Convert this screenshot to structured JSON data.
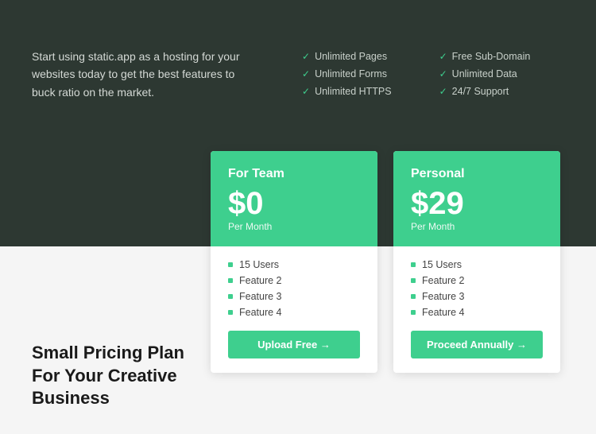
{
  "hero": {
    "description": "Start using static.app as a hosting for your websites today to get the best features to buck ratio on the market."
  },
  "features": {
    "col1": [
      {
        "text": "Unlimited Pages"
      },
      {
        "text": "Unlimited Forms"
      },
      {
        "text": "Unlimited HTTPS"
      }
    ],
    "col2": [
      {
        "text": "Free Sub-Domain"
      },
      {
        "text": "Unlimited Data"
      },
      {
        "text": "24/7 Support"
      }
    ]
  },
  "plans": [
    {
      "id": "team",
      "title": "For Team",
      "price": "$0",
      "period": "Per Month",
      "features": [
        "15 Users",
        "Feature 2",
        "Feature 3",
        "Feature 4"
      ],
      "button_label": "Upload Free →"
    },
    {
      "id": "personal",
      "title": "Personal",
      "price": "$29",
      "period": "Per Month",
      "features": [
        "15 Users",
        "Feature 2",
        "Feature 3",
        "Feature 4"
      ],
      "button_label": "Proceed Annually →"
    }
  ],
  "tagline": {
    "line1": "Small Pricing Plan",
    "line2": "For Your Creative",
    "line3": "Business"
  }
}
